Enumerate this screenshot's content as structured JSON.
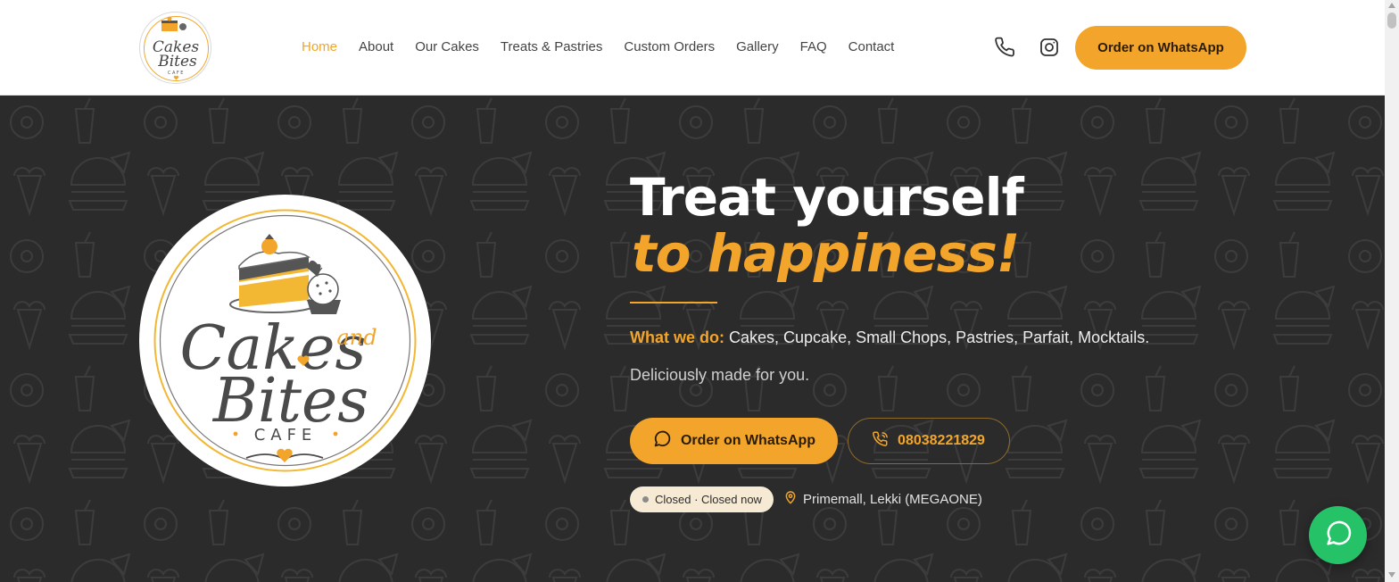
{
  "header": {
    "logo": {
      "name": "Cakes and Bites Cafe logo",
      "word1": "Cakes",
      "word2": "Bites",
      "word3": "CAFE"
    },
    "nav": [
      {
        "label": "Home",
        "active": true
      },
      {
        "label": "About",
        "active": false
      },
      {
        "label": "Our Cakes",
        "active": false
      },
      {
        "label": "Treats & Pastries",
        "active": false
      },
      {
        "label": "Custom Orders",
        "active": false
      },
      {
        "label": "Gallery",
        "active": false
      },
      {
        "label": "FAQ",
        "active": false
      },
      {
        "label": "Contact",
        "active": false
      }
    ],
    "icons": {
      "phone": "phone-icon",
      "instagram": "instagram-icon"
    },
    "cta_label": "Order on WhatsApp"
  },
  "hero": {
    "logo": {
      "cakes": "Cakes",
      "and": "and",
      "bites": "Bites",
      "cafe": "CAFE"
    },
    "title_line1": "Treat yourself",
    "title_line2": "to happiness!",
    "what_label": "What we do:",
    "what_text": "Cakes, Cupcake, Small Chops, Pastries, Parfait, Mocktails.",
    "tagline": "Deliciously made for you.",
    "primary_button": {
      "label": "Order on WhatsApp",
      "icon": "chat-bubble-icon"
    },
    "phone_button": {
      "label": "08038221829",
      "icon": "phone-icon"
    },
    "status": "Closed · Closed now",
    "location": {
      "text": "Primemall, Lekki (MEGAONE)",
      "icon": "map-pin-icon"
    }
  },
  "chat_widget": {
    "icon": "chat-bubble-icon"
  },
  "colors": {
    "accent": "#f2a52a",
    "hero_bg": "#2b2b2b",
    "header_bg": "#ffffff",
    "whatsapp_green": "#25c267",
    "status_bg": "#f6ead4"
  }
}
